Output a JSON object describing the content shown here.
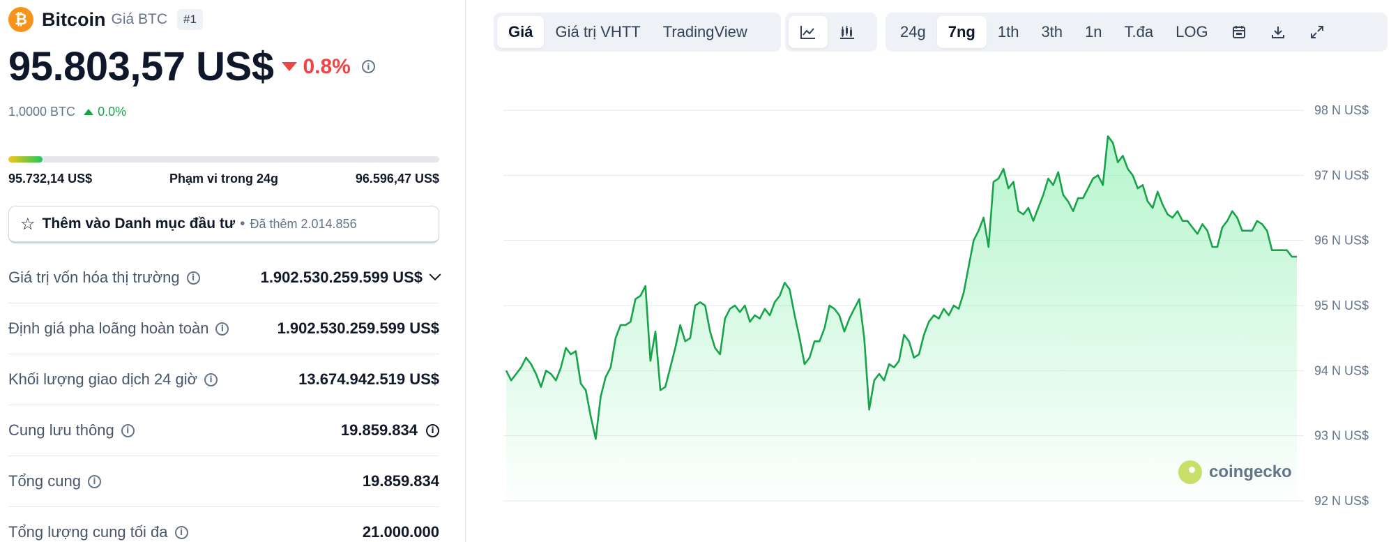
{
  "coin": {
    "logo_glyph": "₿",
    "name": "Bitcoin",
    "subtitle": "Giá BTC",
    "rank": "#1",
    "price": "95.803,57 US$",
    "change_24h": "0.8%",
    "change_direction": "down",
    "btc_amount": "1,0000 BTC",
    "btc_change": "0.0%"
  },
  "range_24h": {
    "low": "95.732,14 US$",
    "label": "Phạm vi trong 24g",
    "high": "96.596,47 US$",
    "position_fraction": 0.08
  },
  "watchlist": {
    "label": "Thêm vào Danh mục đầu tư",
    "separator": "•",
    "added_text": "Đã thêm 2.014.856"
  },
  "stats": [
    {
      "label": "Giá trị vốn hóa thị trường",
      "value": "1.902.530.259.599 US$",
      "extra": "chevron"
    },
    {
      "label": "Định giá pha loãng hoàn toàn",
      "value": "1.902.530.259.599 US$",
      "extra": ""
    },
    {
      "label": "Khối lượng giao dịch 24 giờ",
      "value": "13.674.942.519 US$",
      "extra": ""
    },
    {
      "label": "Cung lưu thông",
      "value": "19.859.834",
      "extra": "info"
    },
    {
      "label": "Tổng cung",
      "value": "19.859.834",
      "extra": ""
    },
    {
      "label": "Tổng lượng cung tối đa",
      "value": "21.000.000",
      "extra": ""
    }
  ],
  "toolbar": {
    "view_tabs": [
      "Giá",
      "Giá trị VHTT",
      "TradingView"
    ],
    "active_view": 0,
    "chart_type_icons": [
      "line-chart-icon",
      "candlestick-icon"
    ],
    "range_tabs": [
      "24g",
      "7ng",
      "1th",
      "3th",
      "1n",
      "T.đa",
      "LOG"
    ],
    "active_range": 1,
    "action_icons": [
      "calendar-icon",
      "download-icon",
      "fullscreen-icon"
    ]
  },
  "colors": {
    "line": "#16a34a",
    "fill_top": "#86efac",
    "up": "#16a34a",
    "down": "#ef4444",
    "brand_orange": "#f7931a"
  },
  "watermark": "coingecko",
  "chart_data": {
    "type": "area",
    "ylim": [
      92000,
      98000
    ],
    "y_ticks": [
      98000,
      97000,
      96000,
      95000,
      94000,
      93000,
      92000
    ],
    "y_tick_labels": [
      "98 N US$",
      "97 N US$",
      "96 N US$",
      "95 N US$",
      "94 N US$",
      "93 N US$",
      "92 N US$"
    ],
    "grid": true,
    "series": [
      {
        "values": [
          94000,
          93850,
          93950,
          94050,
          94200,
          94100,
          93950,
          93750,
          94000,
          93950,
          93850,
          94050,
          94350,
          94250,
          94300,
          93800,
          93700,
          93300,
          92950,
          93600,
          93900,
          94050,
          94500,
          94700,
          94700,
          94750,
          95100,
          95150,
          95300,
          94150,
          94600,
          93700,
          93750,
          94050,
          94350,
          94700,
          94450,
          94500,
          95000,
          95050,
          95000,
          94600,
          94350,
          94250,
          94800,
          94950,
          95000,
          94900,
          95000,
          94750,
          94850,
          94800,
          94950,
          94850,
          95050,
          95150,
          95350,
          95250,
          94850,
          94500,
          94100,
          94200,
          94450,
          94450,
          94650,
          95000,
          94950,
          94850,
          94600,
          94800,
          94950,
          95100,
          94500,
          93400,
          93850,
          93950,
          93850,
          94100,
          94050,
          94150,
          94550,
          94450,
          94200,
          94250,
          94550,
          94750,
          94850,
          94800,
          94950,
          94850,
          95000,
          94950,
          95200,
          95600,
          96000,
          96150,
          96350,
          95900,
          96900,
          96950,
          97100,
          96800,
          96900,
          96450,
          96400,
          96500,
          96300,
          96500,
          96700,
          96950,
          96850,
          97050,
          96700,
          96600,
          96450,
          96650,
          96650,
          96800,
          96950,
          97000,
          96850,
          97600,
          97500,
          97200,
          97300,
          97100,
          97000,
          96800,
          96850,
          96600,
          96500,
          96750,
          96550,
          96400,
          96350,
          96450,
          96300,
          96300,
          96200,
          96100,
          96250,
          96150,
          95900,
          95900,
          96200,
          96300,
          96450,
          96350,
          96150,
          96150,
          96150,
          96300,
          96250,
          96150,
          95850,
          95850,
          95850,
          95850,
          95750,
          95750
        ]
      }
    ]
  }
}
